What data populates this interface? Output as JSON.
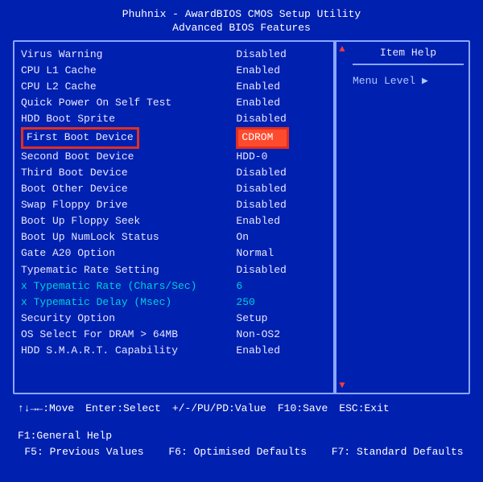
{
  "title_line1": "Phuhnix - AwardBIOS CMOS Setup Utility",
  "title_line2": "Advanced BIOS Features",
  "help": {
    "heading": "Item Help",
    "menu_level_label": "Menu Level",
    "menu_level_arrow": "▶"
  },
  "settings": [
    {
      "label": "Virus Warning",
      "value": "Disabled"
    },
    {
      "label": "CPU L1 Cache",
      "value": "Enabled"
    },
    {
      "label": "CPU L2 Cache",
      "value": "Enabled"
    },
    {
      "label": "Quick Power On Self Test",
      "value": "Enabled"
    },
    {
      "label": "HDD Boot Sprite",
      "value": "Disabled"
    },
    {
      "label": "First Boot Device",
      "value": "CDROM",
      "hl": true
    },
    {
      "label": "Second Boot Device",
      "value": "HDD-0"
    },
    {
      "label": "Third Boot Device",
      "value": "Disabled"
    },
    {
      "label": "Boot Other Device",
      "value": "Disabled"
    },
    {
      "label": "Swap Floppy Drive",
      "value": "Disabled"
    },
    {
      "label": "Boot Up Floppy Seek",
      "value": "Enabled"
    },
    {
      "label": "Boot Up NumLock Status",
      "value": "On"
    },
    {
      "label": "Gate A20 Option",
      "value": "Normal"
    },
    {
      "label": "Typematic Rate Setting",
      "value": "Disabled"
    },
    {
      "label": "Typematic Rate (Chars/Sec)",
      "value": "6",
      "sub": true
    },
    {
      "label": "Typematic Delay (Msec)",
      "value": "250",
      "sub": true
    },
    {
      "label": "Security Option",
      "value": "Setup"
    },
    {
      "label": "OS Select For DRAM > 64MB",
      "value": "Non-OS2"
    },
    {
      "label": "HDD S.M.A.R.T. Capability",
      "value": "Enabled"
    }
  ],
  "footer": {
    "row1": {
      "move": "↑↓→←:Move",
      "select": "Enter:Select",
      "value": "+/-/PU/PD:Value",
      "save": "F10:Save",
      "exit": "ESC:Exit",
      "help": "F1:General Help"
    },
    "row2": {
      "prev": "F5: Previous Values",
      "opt": "F6: Optimised Defaults",
      "std": "F7: Standard Defaults"
    }
  },
  "scroll_up": "▲",
  "scroll_down": "▼"
}
